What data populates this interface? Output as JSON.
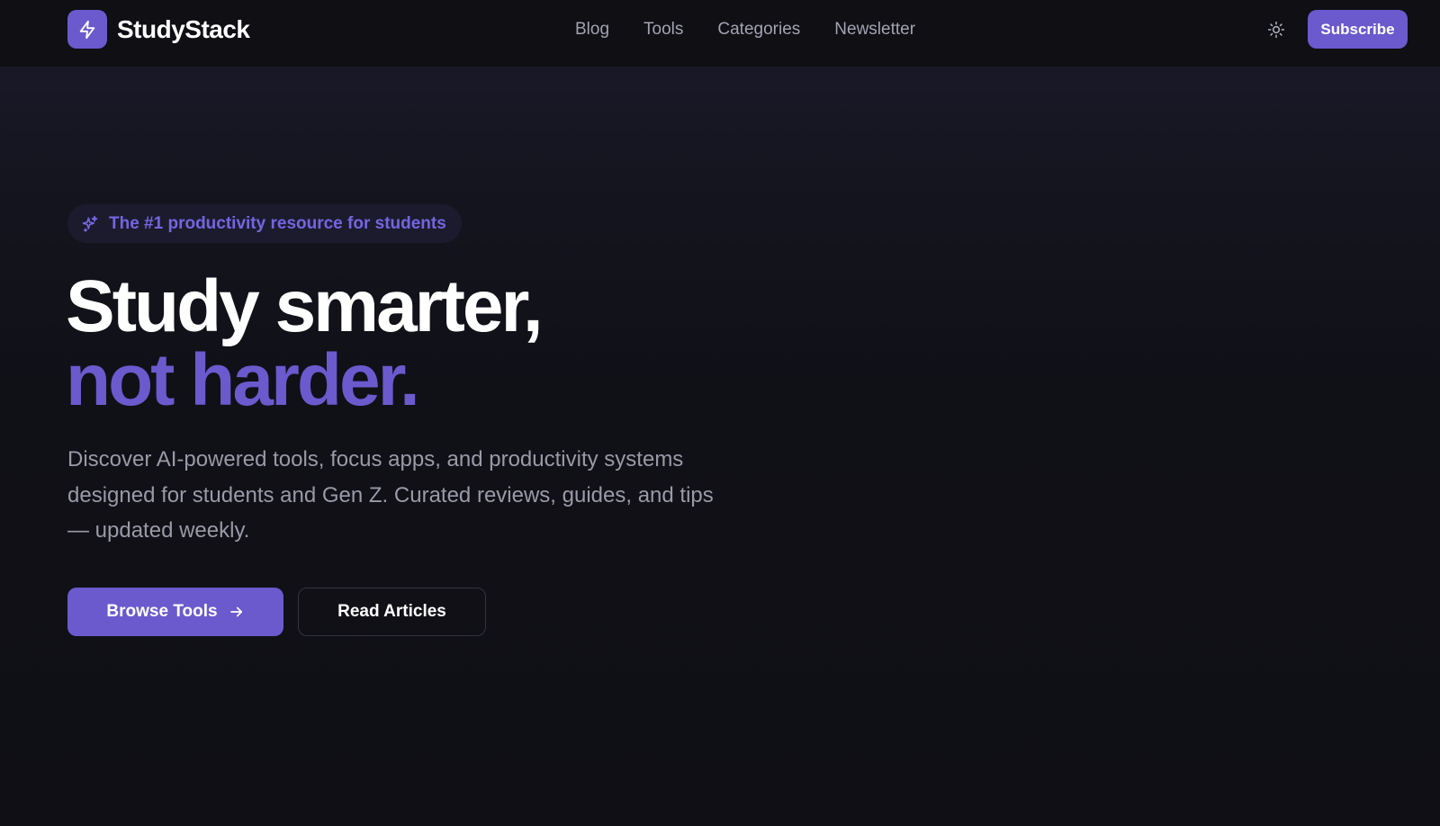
{
  "header": {
    "brand": "StudyStack",
    "logo_icon": "lightning-bolt-icon",
    "nav": [
      {
        "label": "Blog"
      },
      {
        "label": "Tools"
      },
      {
        "label": "Categories"
      },
      {
        "label": "Newsletter"
      }
    ],
    "theme_icon": "sun-icon",
    "subscribe_label": "Subscribe"
  },
  "hero": {
    "badge_icon": "sparkles-icon",
    "badge_text": "The #1 productivity resource for students",
    "headline_line1": "Study smarter,",
    "headline_line2": "not harder.",
    "description": "Discover AI-powered tools, focus apps, and productivity systems designed for students and Gen Z. Curated reviews, guides, and tips — updated weekly.",
    "primary_button": "Browse Tools",
    "primary_button_icon": "arrow-right-icon",
    "secondary_button": "Read Articles"
  },
  "colors": {
    "accent": "#6a5acd",
    "background": "#0f0f15",
    "muted_text": "#9a9aa8"
  }
}
